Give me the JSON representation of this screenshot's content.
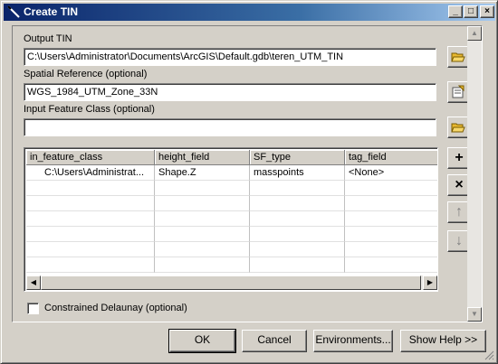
{
  "window": {
    "title": "Create TIN",
    "controls": {
      "minimize": "_",
      "maximize": "□",
      "close": "×"
    }
  },
  "form": {
    "output_tin_label": "Output TIN",
    "output_tin_value": "C:\\Users\\Administrator\\Documents\\ArcGIS\\Default.gdb\\teren_UTM_TIN",
    "spatial_ref_label": "Spatial Reference (optional)",
    "spatial_ref_value": "WGS_1984_UTM_Zone_33N",
    "input_fc_label": "Input Feature Class (optional)",
    "input_fc_value": ""
  },
  "table": {
    "columns": [
      "in_feature_class",
      "height_field",
      "SF_type",
      "tag_field"
    ],
    "rows": [
      [
        "C:\\Users\\Administrat...",
        "Shape.Z",
        "masspoints",
        "<None>"
      ]
    ]
  },
  "side_buttons": {
    "add": "+",
    "remove": "×",
    "up": "↑",
    "down": "↓"
  },
  "checkbox": {
    "label": "Constrained Delaunay (optional)",
    "checked": false
  },
  "footer": {
    "ok": "OK",
    "cancel": "Cancel",
    "environments": "Environments...",
    "show_help": "Show Help >>"
  },
  "colors": {
    "titlebar_start": "#0a246a",
    "titlebar_end": "#a6caf0",
    "face": "#d4d0c8",
    "folder": "#e8b830"
  },
  "icons": {
    "app": "tin-wand-icon",
    "browse": "open-folder-icon",
    "spatial_ref": "properties-icon"
  }
}
